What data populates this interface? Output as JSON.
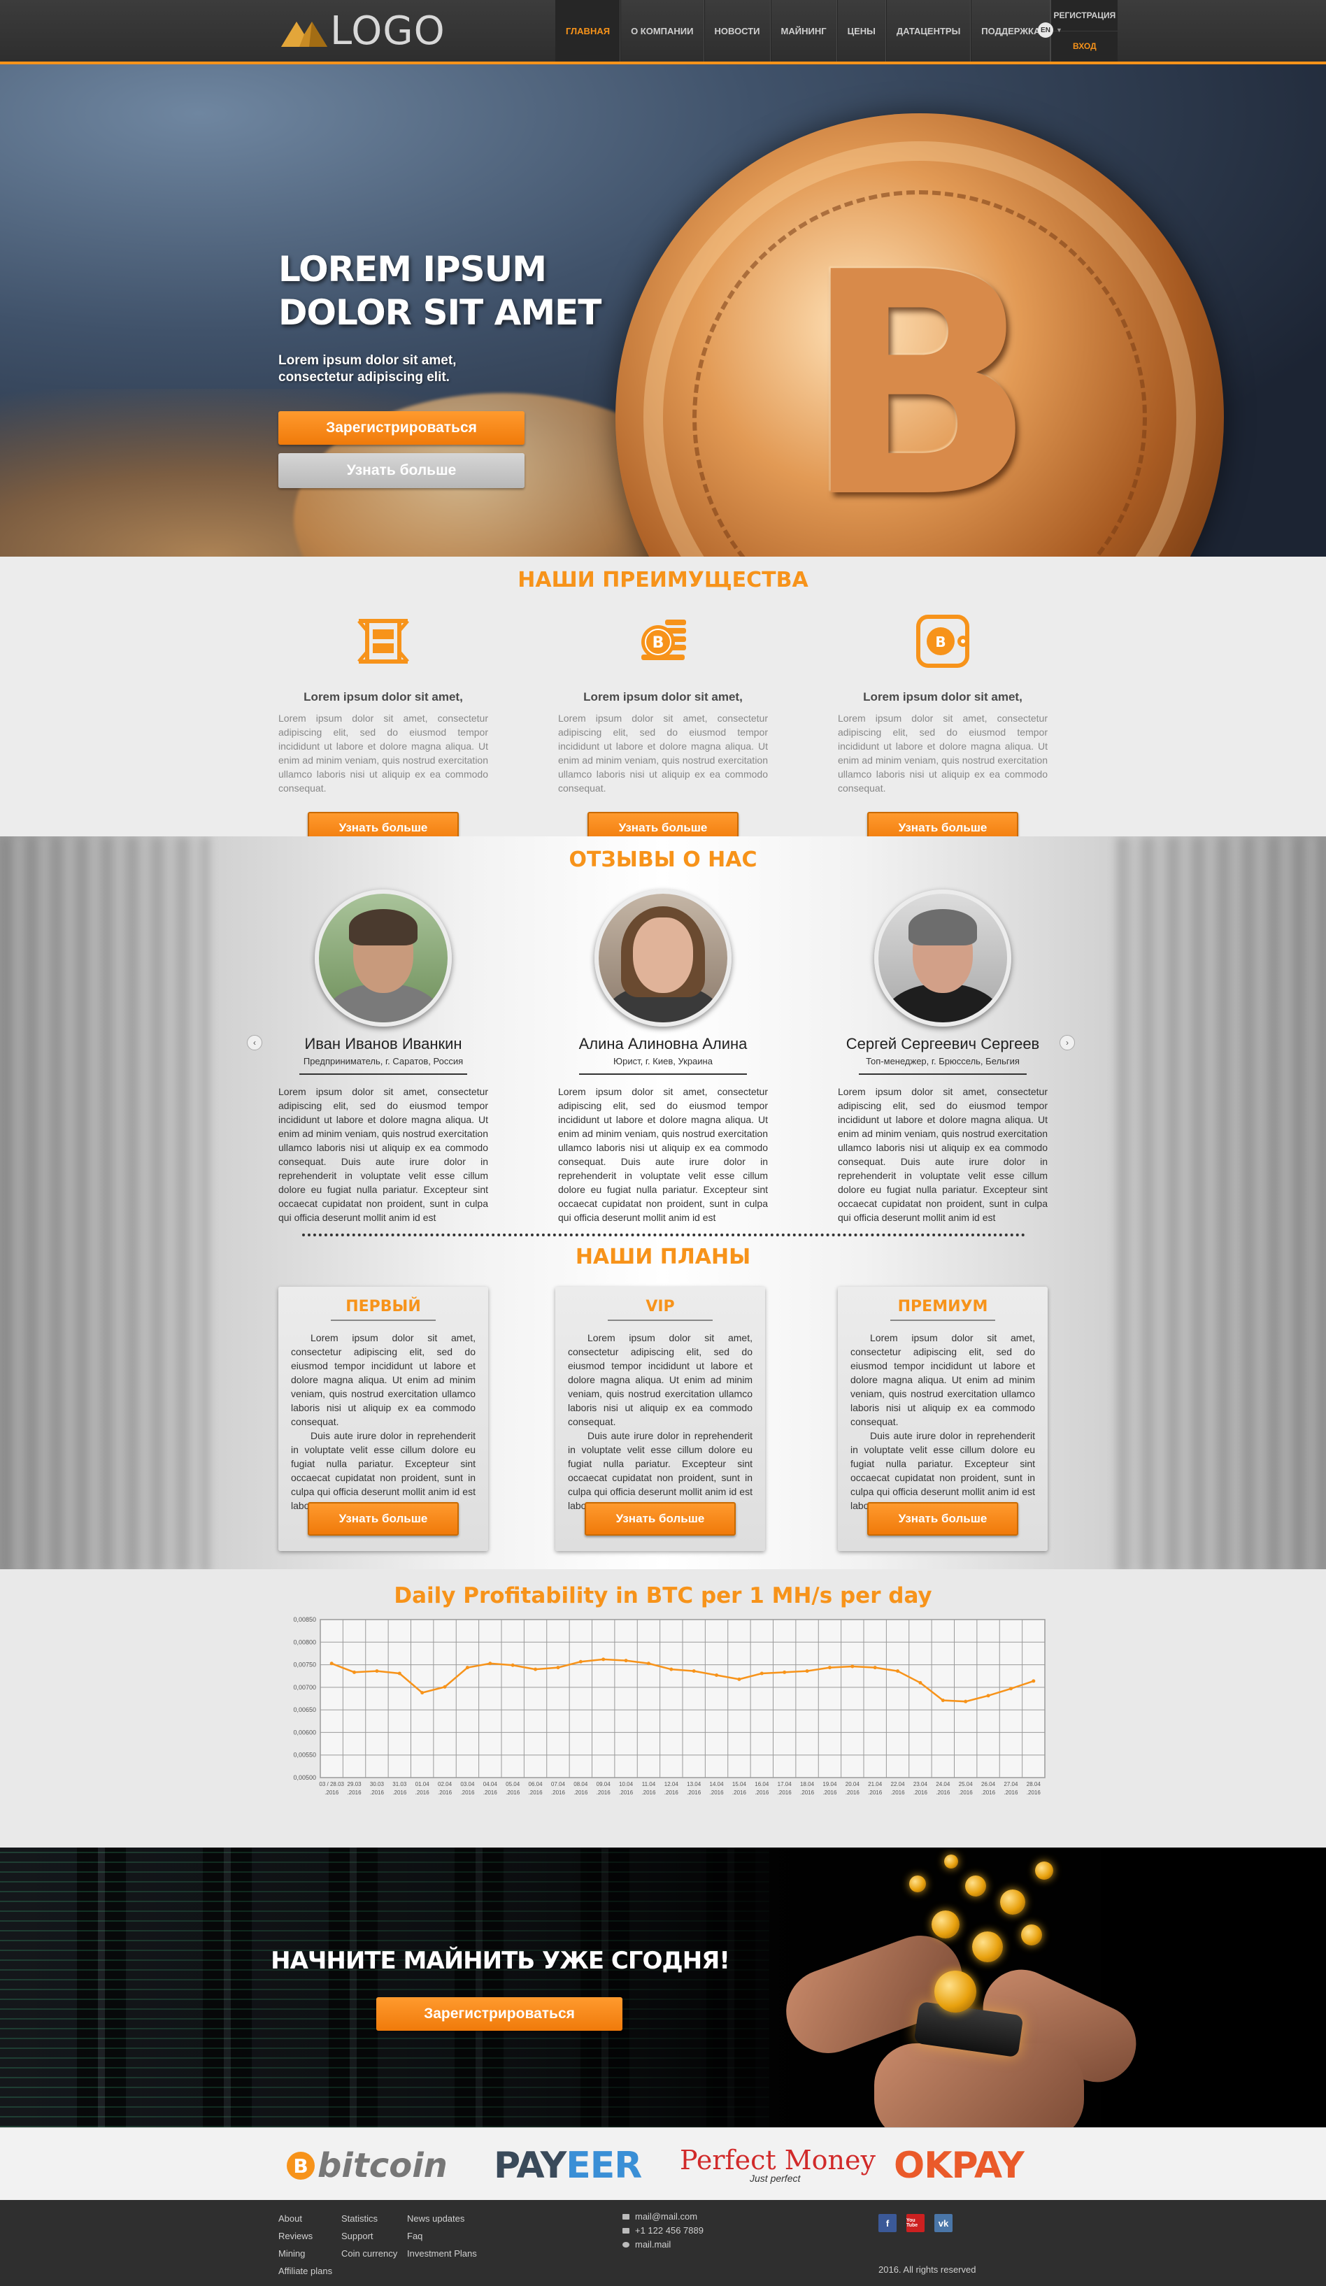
{
  "header": {
    "logo_text": "LOGO",
    "nav": [
      {
        "label": "ГЛАВНАЯ",
        "active": true
      },
      {
        "label": "О КОМПАНИИ",
        "active": false
      },
      {
        "label": "НОВОСТИ",
        "active": false
      },
      {
        "label": "МАЙНИНГ",
        "active": false
      },
      {
        "label": "ЦЕНЫ",
        "active": false
      },
      {
        "label": "ДАТАЦЕНТРЫ",
        "active": false
      },
      {
        "label": "ПОДДЕРЖКА",
        "active": false
      }
    ],
    "register": "РЕГИСТРАЦИЯ",
    "login": "ВХОД",
    "lang": "EN"
  },
  "hero": {
    "title_line1": "LOREM IPSUM",
    "title_line2": "DOLOR SIT AMET",
    "subtitle": "Lorem ipsum dolor sit amet, consectetur adipiscing elit.",
    "btn_register": "Зарегистрироваться",
    "btn_more": "Узнать больше",
    "coin_symbol": "B"
  },
  "advantages": {
    "title": "НАШИ ПРЕИМУЩЕСТВА",
    "items": [
      {
        "icon": "film-frame-icon",
        "title": "Lorem ipsum dolor sit amet,",
        "text": "Lorem ipsum dolor sit amet, consectetur adipiscing elit, sed do eiusmod tempor incididunt ut labore et dolore magna aliqua. Ut enim ad minim veniam, quis nostrud exercitation ullamco laboris nisi ut aliquip ex ea commodo consequat.",
        "button": "Узнать больше"
      },
      {
        "icon": "bitcoin-stack-icon",
        "title": "Lorem ipsum dolor sit amet,",
        "text": "Lorem ipsum dolor sit amet, consectetur adipiscing elit, sed do eiusmod tempor incididunt ut labore et dolore magna aliqua. Ut enim ad minim veniam, quis nostrud exercitation ullamco laboris nisi ut aliquip ex ea commodo consequat.",
        "button": "Узнать больше"
      },
      {
        "icon": "bitcoin-wallet-icon",
        "title": "Lorem ipsum dolor sit amet,",
        "text": "Lorem ipsum dolor sit amet, consectetur adipiscing elit, sed do eiusmod tempor incididunt ut labore et dolore magna aliqua. Ut enim ad minim veniam, quis nostrud exercitation ullamco laboris nisi ut aliquip ex ea commodo consequat.",
        "button": "Узнать больше"
      }
    ]
  },
  "reviews": {
    "title": "ОТЗЫВЫ О НАС",
    "prev_icon": "chevron-left-icon",
    "next_icon": "chevron-right-icon",
    "items": [
      {
        "name": "Иван Иванов Иванкин",
        "role": "Предприниматель, г. Саратов, Россия",
        "text": "Lorem ipsum dolor sit amet, consectetur adipiscing elit, sed do eiusmod tempor incididunt ut labore et dolore magna aliqua. Ut enim ad minim veniam, quis nostrud exercitation ullamco laboris nisi ut aliquip ex ea commodo consequat. Duis aute irure dolor in reprehenderit in voluptate velit esse cillum dolore eu fugiat nulla pariatur. Excepteur sint occaecat cupidatat non proident, sunt in culpa qui officia deserunt mollit anim id est"
      },
      {
        "name": "Алина Алиновна Алина",
        "role": "Юрист, г. Киев, Украина",
        "text": "Lorem ipsum dolor sit amet, consectetur adipiscing elit, sed do eiusmod tempor incididunt ut labore et dolore magna aliqua. Ut enim ad minim veniam, quis nostrud exercitation ullamco laboris nisi ut aliquip ex ea commodo consequat. Duis aute irure dolor in reprehenderit in voluptate velit esse cillum dolore eu fugiat nulla pariatur. Excepteur sint occaecat cupidatat non proident, sunt in culpa qui officia deserunt mollit anim id est"
      },
      {
        "name": "Сергей Сергеевич Сергеев",
        "role": "Топ-менеджер, г. Брюссель, Бельгия",
        "text": "Lorem ipsum dolor sit amet, consectetur adipiscing elit, sed do eiusmod tempor incididunt ut labore et dolore magna aliqua. Ut enim ad minim veniam, quis nostrud exercitation ullamco laboris nisi ut aliquip ex ea commodo consequat. Duis aute irure dolor in reprehenderit in voluptate velit esse cillum dolore eu fugiat nulla pariatur. Excepteur sint occaecat cupidatat non proident, sunt in culpa qui officia deserunt mollit anim id est"
      }
    ]
  },
  "plans": {
    "title": "НАШИ ПЛАНЫ",
    "items": [
      {
        "title": "ПЕРВЫЙ",
        "text1": "Lorem ipsum dolor sit amet, consectetur adipiscing elit, sed do eiusmod tempor incididunt ut labore et dolore magna aliqua. Ut enim ad minim veniam, quis nostrud exercitation ullamco laboris nisi ut aliquip ex ea commodo consequat.",
        "text2": "Duis aute irure dolor in reprehenderit in voluptate velit esse cillum dolore eu fugiat nulla pariatur. Excepteur sint occaecat cupidatat non proident, sunt in culpa qui officia deserunt mollit anim id est laborum.",
        "button": "Узнать больше"
      },
      {
        "title": "VIP",
        "text1": "Lorem ipsum dolor sit amet, consectetur adipiscing elit, sed do eiusmod tempor incididunt ut labore et dolore magna aliqua. Ut enim ad minim veniam, quis nostrud exercitation ullamco laboris nisi ut aliquip ex ea commodo consequat.",
        "text2": "Duis aute irure dolor in reprehenderit in voluptate velit esse cillum dolore eu fugiat nulla pariatur. Excepteur sint occaecat cupidatat non proident, sunt in culpa qui officia deserunt mollit anim id est laborum.",
        "button": "Узнать больше"
      },
      {
        "title": "ПРЕМИУМ",
        "text1": "Lorem ipsum dolor sit amet, consectetur adipiscing elit, sed do eiusmod tempor incididunt ut labore et dolore magna aliqua. Ut enim ad minim veniam, quis nostrud exercitation ullamco laboris nisi ut aliquip ex ea commodo consequat.",
        "text2": "Duis aute irure dolor in reprehenderit in voluptate velit esse cillum dolore eu fugiat nulla pariatur. Excepteur sint occaecat cupidatat non proident, sunt in culpa qui officia deserunt mollit anim id est laborum.",
        "button": "Узнать больше"
      }
    ]
  },
  "chart_data": {
    "type": "line",
    "title": "Daily Profitability in BTC per 1 MH/s per day",
    "xlabel": "",
    "ylabel": "",
    "ylim": [
      0.0058,
      0.0085
    ],
    "yticks": [
      "0,00850",
      "0,00800",
      "0,00750",
      "0,00700",
      "0,00650",
      "0,00600",
      "0,00550",
      "0,00500"
    ],
    "categories": [
      "03 / 28.03 .2016",
      "29.03 .2016",
      "30.03 .2016",
      "31.03 .2016",
      "01.04 .2016",
      "02.04 .2016",
      "03.04 .2016",
      "04.04 .2016",
      "05.04 .2016",
      "06.04 .2016",
      "07.04 .2016",
      "08.04 .2016",
      "09.04 .2016",
      "10.04 .2016",
      "11.04 .2016",
      "12.04 .2016",
      "13.04 .2016",
      "14.04 .2016",
      "15.04 .2016",
      "16.04 .2016",
      "17.04 .2016",
      "18.04 .2016",
      "19.04 .2016",
      "20.04 .2016",
      "21.04 .2016",
      "22.04 .2016",
      "23.04 .2016",
      "24.04 .2016",
      "25.04 .2016",
      "26.04 .2016",
      "27.04 .2016",
      "28.04 .2016"
    ],
    "values": [
      0.00775,
      0.0076,
      0.00762,
      0.00758,
      0.00725,
      0.00735,
      0.00768,
      0.00775,
      0.00772,
      0.00765,
      0.00768,
      0.00778,
      0.00782,
      0.0078,
      0.00775,
      0.00765,
      0.00762,
      0.00755,
      0.00748,
      0.00758,
      0.0076,
      0.00762,
      0.00768,
      0.0077,
      0.00768,
      0.00762,
      0.00742,
      0.00712,
      0.0071,
      0.0072,
      0.00732,
      0.00745
    ],
    "color": "#f7931a",
    "grid": true
  },
  "cta": {
    "title": "НАЧНИТЕ МАЙНИТЬ УЖЕ СГОДНЯ!",
    "button": "Зарегистрироваться"
  },
  "payments": {
    "bitcoin": "bitcoin",
    "payeer_a": "PAY",
    "payeer_b": "EER",
    "pm_main": "Perfect Money",
    "pm_sub": "Just perfect",
    "okpay": "OKPAY"
  },
  "footer": {
    "col1": [
      "About",
      "Reviews",
      "Mining",
      "Affiliate plans"
    ],
    "col2": [
      "Statistics",
      "Support",
      "Coin currency"
    ],
    "col3": [
      "News updates",
      "Faq",
      "Investment Plans"
    ],
    "email": "mail@mail.com",
    "phone": "+1 122 456 7889",
    "skype": "mail.mail",
    "social": [
      "f",
      "You Tube",
      "vk"
    ],
    "copyright": "2016. All rights reserved"
  },
  "colors": {
    "accent": "#f7931a",
    "header_bg": "#333333",
    "footer_bg": "#2f2f2f"
  }
}
